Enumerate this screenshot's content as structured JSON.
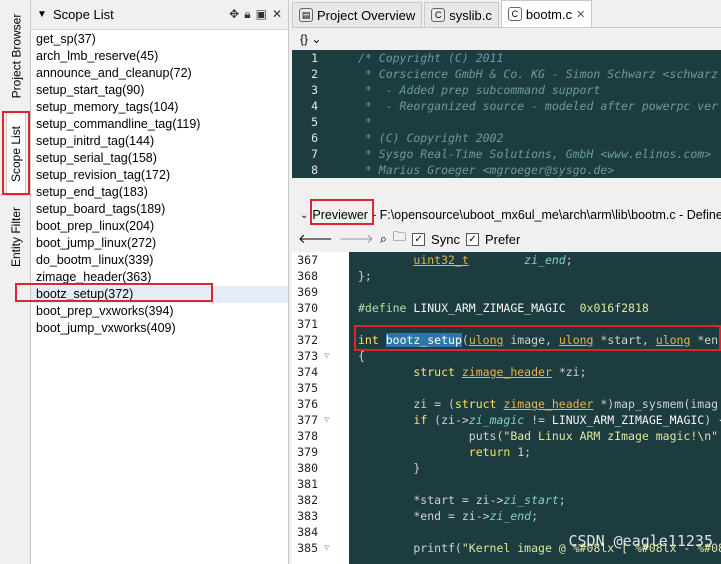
{
  "side_tabs": {
    "project_browser": "Project Browser",
    "scope_list": "Scope List",
    "entity_filter": "Entity Filter"
  },
  "scope_panel": {
    "title": "Scope List",
    "items": [
      "get_sp(37)",
      "arch_lmb_reserve(45)",
      "announce_and_cleanup(72)",
      "setup_start_tag(90)",
      "setup_memory_tags(104)",
      "setup_commandline_tag(119)",
      "setup_initrd_tag(144)",
      "setup_serial_tag(158)",
      "setup_revision_tag(172)",
      "setup_end_tag(183)",
      "setup_board_tags(189)",
      "boot_prep_linux(204)",
      "boot_jump_linux(272)",
      "do_bootm_linux(339)",
      "zimage_header(363)",
      "bootz_setup(372)",
      "boot_prep_vxworks(394)",
      "boot_jump_vxworks(409)"
    ]
  },
  "tabs": [
    "Project Overview",
    "syslib.c",
    "bootm.c"
  ],
  "editor_toolbar": "{} ⌄",
  "top_code": {
    "lines": [
      {
        "n": "1",
        "t": "/* Copyright (C) 2011"
      },
      {
        "n": "2",
        "t": " * Corscience GmbH & Co. KG - Simon Schwarz <schwarz"
      },
      {
        "n": "3",
        "t": " *  - Added prep subcommand support"
      },
      {
        "n": "4",
        "t": " *  - Reorganized source - modeled after powerpc ver"
      },
      {
        "n": "5",
        "t": " *"
      },
      {
        "n": "6",
        "t": " * (C) Copyright 2002"
      },
      {
        "n": "7",
        "t": " * Sysgo Real-Time Solutions, GmbH <www.elinos.com>"
      },
      {
        "n": "8",
        "t": " * Marius Groeger <mgroeger@sysgo.de>"
      }
    ]
  },
  "previewer": {
    "label": "Previewer",
    "path": " - F:\\opensource\\uboot_mx6ul_me\\arch\\arm\\lib\\bootm.c - Define"
  },
  "preview_toolbar": {
    "sync": "Sync",
    "prefer": "Prefer"
  },
  "preview_code": {
    "lines": [
      "367",
      "368",
      "369",
      "370",
      "371",
      "372",
      "373",
      "374",
      "375",
      "376",
      "377",
      "378",
      "379",
      "380",
      "381",
      "382",
      "383",
      "384",
      "385"
    ]
  },
  "watermark": "CSDN @eagle11235"
}
